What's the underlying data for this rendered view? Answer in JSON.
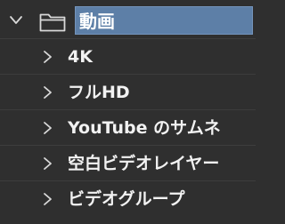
{
  "group": {
    "name": "動画",
    "expanded": true,
    "icon": "folder-icon",
    "children": [
      {
        "label": "4K"
      },
      {
        "label": "フルHD"
      },
      {
        "label": "YouTube のサムネ"
      },
      {
        "label": "空白ビデオレイヤー"
      },
      {
        "label": "ビデオグループ"
      }
    ]
  },
  "colors": {
    "background": "#2f2f2f",
    "selection": "#5d7fa7",
    "text": "#f2f2f2",
    "icon": "#d9d9d9"
  }
}
